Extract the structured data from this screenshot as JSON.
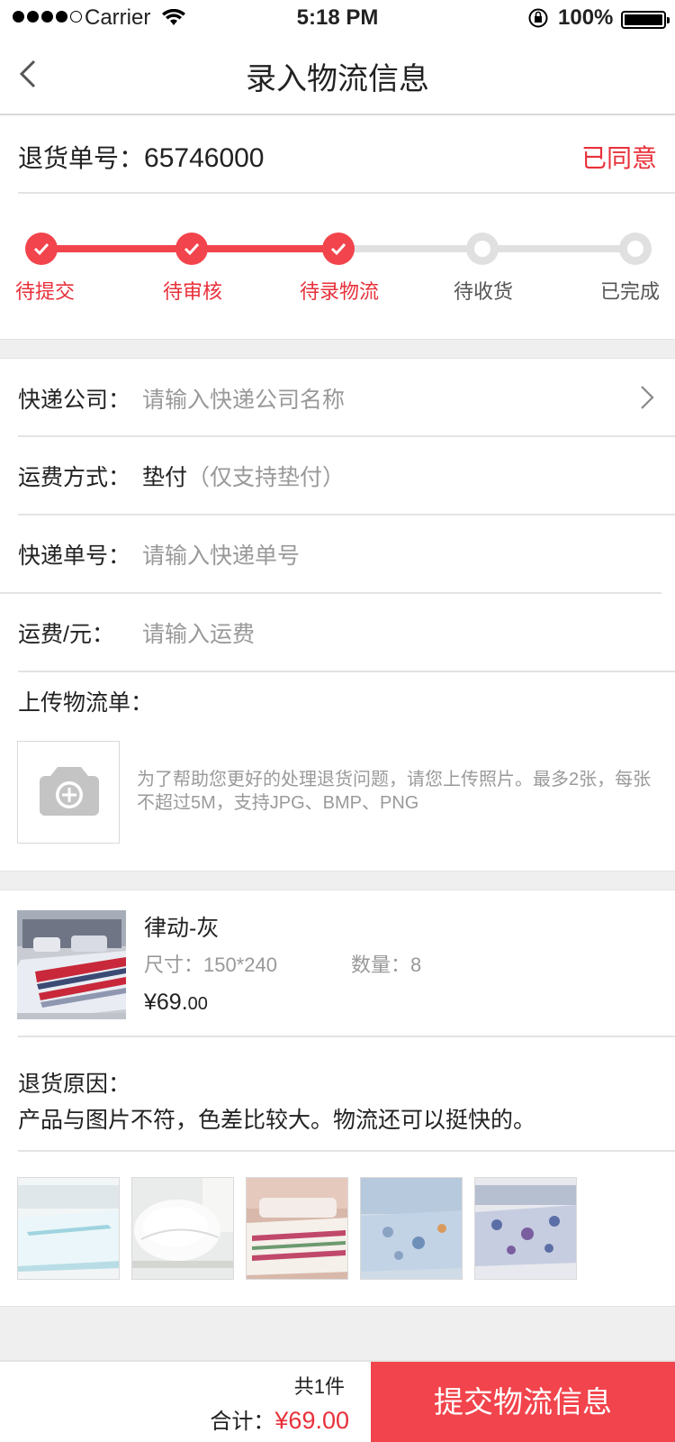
{
  "status_bar": {
    "carrier": "Carrier",
    "time": "5:18 PM",
    "battery": "100%"
  },
  "nav": {
    "title": "录入物流信息"
  },
  "order": {
    "label": "退货单号：",
    "number": "65746000",
    "status": "已同意",
    "status_color": "#e8303a"
  },
  "progress": {
    "steps": [
      {
        "label": "待提交",
        "state": "done"
      },
      {
        "label": "待审核",
        "state": "done"
      },
      {
        "label": "待录物流",
        "state": "done"
      },
      {
        "label": "待收货",
        "state": "todo"
      },
      {
        "label": "已完成",
        "state": "todo"
      }
    ]
  },
  "form": {
    "courier": {
      "label": "快递公司：",
      "placeholder": "请输入快递公司名称"
    },
    "freight_method": {
      "label": "运费方式：",
      "value": "垫付",
      "note": "（仅支持垫付）"
    },
    "tracking": {
      "label": "快递单号：",
      "placeholder": "请输入快递单号"
    },
    "freight": {
      "label": "运费/元：",
      "placeholder": "请输入运费"
    },
    "upload": {
      "label": "上传物流单：",
      "hint": "为了帮助您更好的处理退货问题，请您上传照片。最多2张，每张不超过5M，支持JPG、BMP、PNG"
    }
  },
  "product": {
    "name": "律动-灰",
    "size": "尺寸：150*240",
    "qty": "数量：8",
    "price_main": "¥69.",
    "price_cents": "00"
  },
  "reason": {
    "label": "退货原因：",
    "text": "产品与图片不符，色差比较大。物流还可以挺快的。"
  },
  "bottom": {
    "count": "共1件",
    "total_label": "合计：",
    "total_amount": "¥69.00",
    "submit": "提交物流信息"
  },
  "colors": {
    "accent": "#f2444c",
    "gap": "#f0eff0"
  }
}
